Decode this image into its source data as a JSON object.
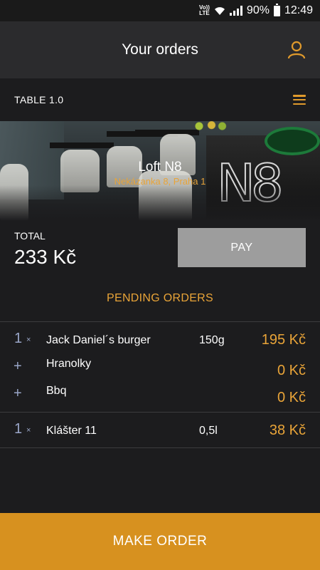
{
  "status_bar": {
    "volte": "Vo)) LTE",
    "battery": "90%",
    "time": "12:49"
  },
  "header": {
    "title": "Your orders",
    "user_icon": "user-icon"
  },
  "table_bar": {
    "label": "TABLE 1.0",
    "menu_icon": "hamburger-menu-icon"
  },
  "venue": {
    "name": "Loft N8",
    "address": "Nekázanka 8, Praha 1",
    "sign_text": "N8"
  },
  "total": {
    "label": "TOTAL",
    "value": "233 Kč"
  },
  "pay_button": "PAY",
  "pending_title": "PENDING ORDERS",
  "orders": [
    {
      "qty": "1",
      "times": "×",
      "item": "Jack Daniel´s burger",
      "size": "150g",
      "price": "195 Kč",
      "extras": [
        {
          "symbol": "+",
          "item": "Hranolky",
          "price": "0 Kč"
        },
        {
          "symbol": "+",
          "item": "Bbq",
          "price": "0 Kč"
        }
      ]
    },
    {
      "qty": "1",
      "times": "×",
      "item": "Klášter 11",
      "size": "0,5l",
      "price": "38 Kč",
      "extras": []
    }
  ],
  "make_order_button": "MAKE ORDER",
  "colors": {
    "accent": "#e9a438",
    "make_order_bg": "#d7911f",
    "pay_bg": "#9d9d9d",
    "background": "#1c1c1e",
    "header_bg": "#2b2b2d"
  }
}
